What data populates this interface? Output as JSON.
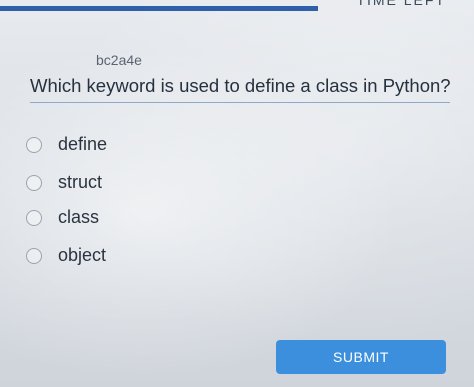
{
  "header": {
    "time_left_label": "TIME LEFT"
  },
  "question": {
    "id": "bc2a4e",
    "text": "Which keyword is used to define a class in Python?",
    "options": [
      {
        "label": "define"
      },
      {
        "label": "struct"
      },
      {
        "label": "class"
      },
      {
        "label": "object"
      }
    ]
  },
  "actions": {
    "submit_label": "SUBMIT"
  },
  "colors": {
    "progress_bar": "#2e5fa8",
    "submit_button": "#3c8fdc"
  }
}
